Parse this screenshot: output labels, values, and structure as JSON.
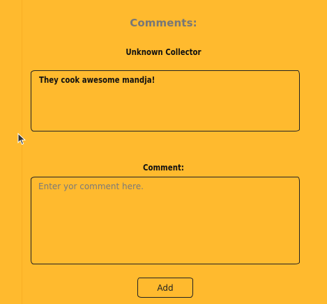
{
  "header": {
    "title": "Comments:"
  },
  "existing_comment": {
    "author": "Unknown Collector",
    "text": "They cook awesome mandja!"
  },
  "new_comment": {
    "label": "Comment:",
    "placeholder": "Enter yor comment here.",
    "value": ""
  },
  "actions": {
    "add_label": "Add"
  },
  "colors": {
    "background": "#ffba2e",
    "border": "#222222",
    "placeholder": "#7a7a7a"
  }
}
